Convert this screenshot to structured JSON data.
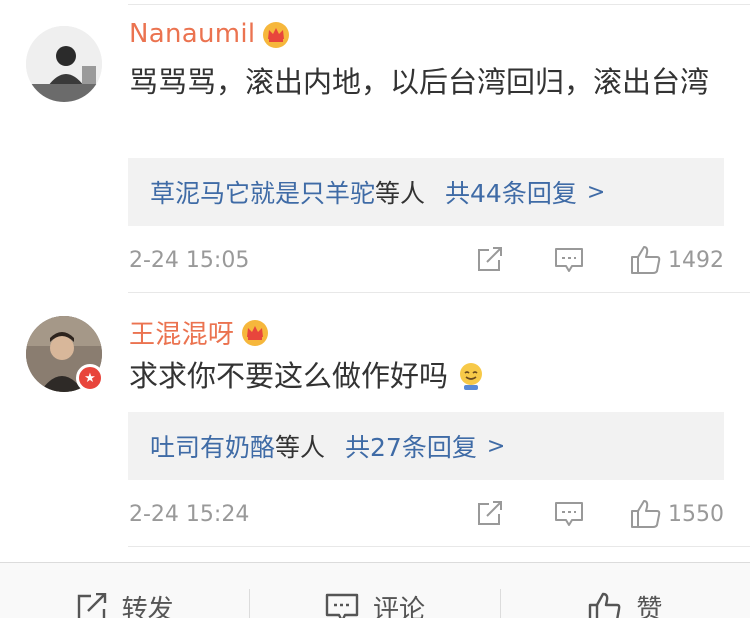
{
  "comments": [
    {
      "username": "Nanaumil",
      "text": "骂骂骂，滚出内地，以后台湾回归，滚出台湾",
      "reply_preview": {
        "names": "草泥马它就是只羊驼",
        "suffix": "等人",
        "count": "共44条回复",
        "chevron": ">"
      },
      "time": "2-24 15:05",
      "likes": "1492"
    },
    {
      "username": "王混混呀",
      "text": "求求你不要这么做作好吗",
      "reply_preview": {
        "names": "吐司有奶酪",
        "suffix": "等人",
        "count": "共27条回复",
        "chevron": ">"
      },
      "time": "2-24 15:24",
      "likes": "1550"
    }
  ],
  "bottom_bar": {
    "repost": "转发",
    "comment": "评论",
    "like": "赞"
  },
  "icons": {
    "crown": "crown-icon",
    "share": "share-icon",
    "reply": "comment-icon",
    "like": "thumbs-up-icon",
    "emoji": "smile-emoji-icon",
    "badge": "star-badge-icon"
  },
  "colors": {
    "username": "#eb7350",
    "link": "#3f6ba6",
    "meta": "#999999",
    "reply_bg": "#f2f2f2",
    "badge": "#e8453c"
  }
}
